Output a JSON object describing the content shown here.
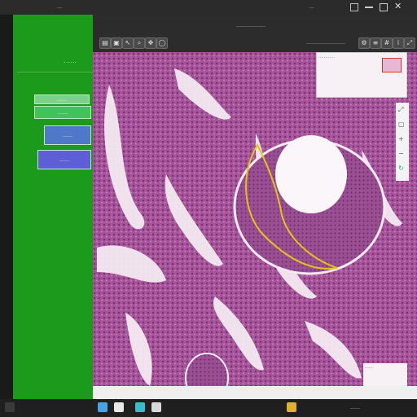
{
  "top_bar": {
    "left_text": "…",
    "right_text": "…",
    "right_icons": [
      "window-icon",
      "minimize-icon",
      "maximize-icon",
      "close-icon"
    ]
  },
  "side_panel": {
    "heading": "……",
    "path_text": "………………………………………………",
    "buttons": [
      {
        "label": "……",
        "color": "#3fc35a"
      },
      {
        "label": "……",
        "color": "#4f78c9"
      },
      {
        "label": "……",
        "color": "#5c5fd6"
      }
    ]
  },
  "toolbar": {
    "left_icons": [
      "folder-icon",
      "save-icon",
      "cursor-icon",
      "zoom-icon",
      "pan-icon",
      "shape-icon"
    ],
    "center_text": "………………",
    "right_text": "……………………",
    "right_icons": [
      "settings-icon",
      "layers-icon",
      "grid-icon",
      "info-icon",
      "expand-icon"
    ]
  },
  "viewer": {
    "description_color": "#b66fa5",
    "annotation_color": "#e2c419",
    "overview_box_text": "…………",
    "scale_box_text": "……",
    "side_icons": [
      "expand-icon",
      "fit-icon",
      "zoom-in-icon",
      "zoom-out-icon",
      "rotate-icon"
    ]
  },
  "taskbar": {
    "start_icon": "start-icon",
    "apps": [
      "explorer-icon",
      "browser-icon",
      "terminal-icon",
      "viewer-icon",
      "settings-icon"
    ],
    "tray_text": "……"
  }
}
